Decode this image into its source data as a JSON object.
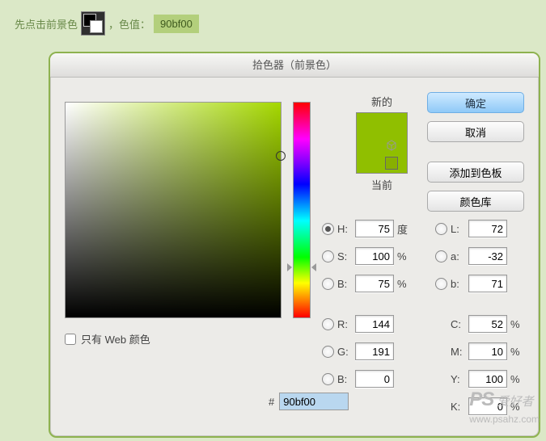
{
  "instruction": {
    "before": "先点击前景色",
    "after": "，色值：",
    "value": "90bf00"
  },
  "window": {
    "title": "拾色器（前景色）"
  },
  "preview": {
    "new_label": "新的",
    "cur_label": "当前"
  },
  "buttons": {
    "ok": "确定",
    "cancel": "取消",
    "add_swatch": "添加到色板",
    "color_lib": "颜色库"
  },
  "hsb": {
    "h_label": "H:",
    "h_value": "75",
    "h_unit": "度",
    "s_label": "S:",
    "s_value": "100",
    "s_unit": "%",
    "b_label": "B:",
    "b_value": "75",
    "b_unit": "%"
  },
  "lab": {
    "l_label": "L:",
    "l_value": "72",
    "a_label": "a:",
    "a_value": "-32",
    "b_label": "b:",
    "b_value": "71"
  },
  "rgb": {
    "r_label": "R:",
    "r_value": "144",
    "g_label": "G:",
    "g_value": "191",
    "b_label": "B:",
    "b_value": "0"
  },
  "cmyk": {
    "c_label": "C:",
    "c_value": "52",
    "unit": "%",
    "m_label": "M:",
    "m_value": "10",
    "y_label": "Y:",
    "y_value": "100",
    "k_label": "K:",
    "k_value": "0"
  },
  "hex": {
    "prefix": "#",
    "value": "90bf00"
  },
  "web_only": {
    "label": "只有 Web 颜色"
  },
  "watermark": {
    "brand": "PS",
    "tag": "爱好者",
    "url": "www.psahz.com"
  }
}
